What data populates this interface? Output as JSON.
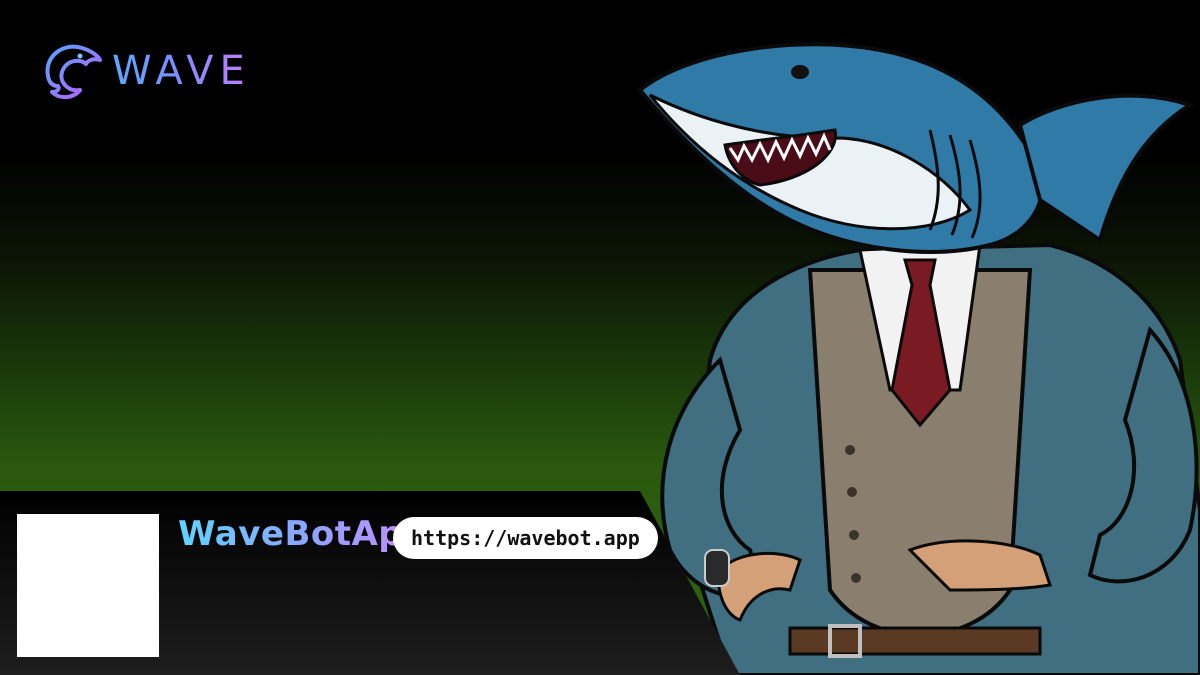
{
  "logo": {
    "text": "WAVE",
    "icon": "dolphin-icon"
  },
  "profile": {
    "name": "WaveBotApp",
    "url": "https://wavebot.app"
  },
  "illustration": {
    "subject": "shark-in-suit"
  },
  "colors": {
    "background_top": "#000000",
    "background_bottom": "#2f6410",
    "footer": "#111111",
    "pill": "#ffffff"
  }
}
